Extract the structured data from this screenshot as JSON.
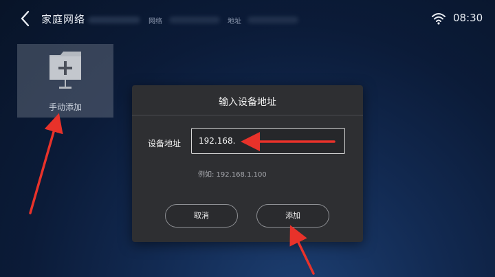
{
  "topbar": {
    "title": "家庭网络",
    "network_label": "网络",
    "address_label": "地址",
    "time": "08:30"
  },
  "tile": {
    "label": "手动添加",
    "icon": "folder-plus-icon"
  },
  "dialog": {
    "title": "输入设备地址",
    "field_label": "设备地址",
    "field_value": "192.168.",
    "hint": "例如: 192.168.1.100",
    "cancel_label": "取消",
    "add_label": "添加"
  },
  "colors": {
    "annotation_arrow": "#e8322a",
    "dialog_bg": "#2e2f32",
    "tile_bg": "#6e7887"
  }
}
